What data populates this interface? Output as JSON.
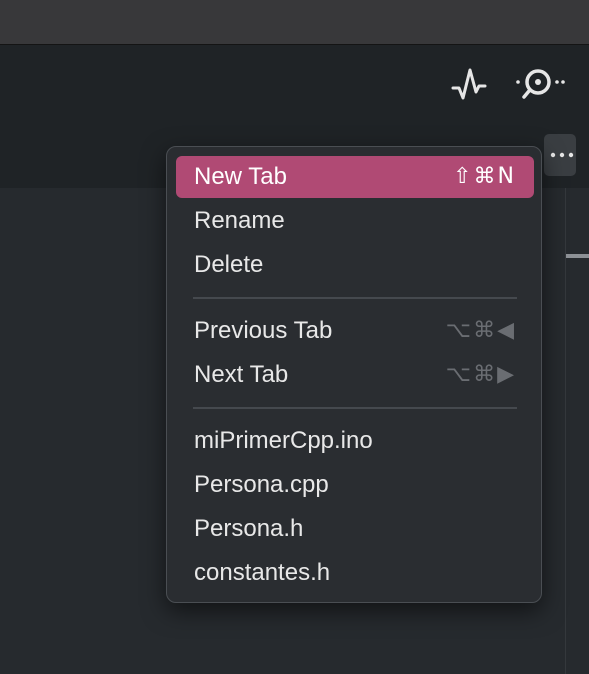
{
  "toolbar": {
    "serial_plotter_icon": "serial-plotter-icon",
    "serial_monitor_icon": "serial-monitor-icon",
    "more_icon": "ellipsis-icon"
  },
  "menu": {
    "items": [
      {
        "label": "New Tab",
        "shortcut": "⇧⌘N",
        "highlighted": true
      },
      {
        "label": "Rename",
        "shortcut": ""
      },
      {
        "label": "Delete",
        "shortcut": ""
      },
      {
        "label": "Previous Tab",
        "shortcut": "⌥⌘◀"
      },
      {
        "label": "Next Tab",
        "shortcut": "⌥⌘▶"
      },
      {
        "label": "miPrimerCpp.ino",
        "shortcut": ""
      },
      {
        "label": "Persona.cpp",
        "shortcut": ""
      },
      {
        "label": "Persona.h",
        "shortcut": ""
      },
      {
        "label": "constantes.h",
        "shortcut": ""
      }
    ]
  },
  "colors": {
    "highlight": "#b04a74",
    "menu_bg": "#2a2d31",
    "toolbar_bg": "#1f2326",
    "editor_bg": "#262a2e"
  }
}
